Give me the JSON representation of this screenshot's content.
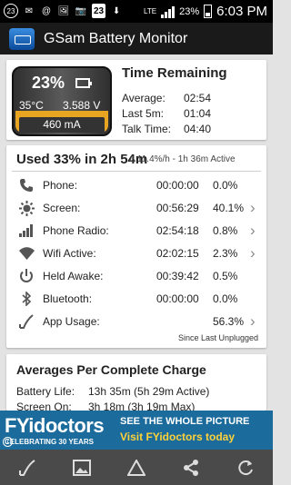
{
  "status_bar": {
    "left_icons": [
      "23",
      "✉",
      "@",
      "🖼",
      "📷",
      "23",
      "⬇"
    ],
    "network": "LTE",
    "battery_pct": "23%",
    "time": "6:03 PM"
  },
  "app": {
    "title": "GSam Battery Monitor"
  },
  "battery_card": {
    "percent": "23%",
    "temperature": "35°C",
    "voltage": "3.588 V",
    "current": "460 mA",
    "level": 0.23,
    "fill_color": "#e7a522"
  },
  "time_remaining": {
    "title": "Time Remaining",
    "rows": [
      {
        "label": "Average:",
        "value": "02:54"
      },
      {
        "label": "Last 5m:",
        "value": "01:04"
      },
      {
        "label": "Talk Time:",
        "value": "04:40"
      }
    ]
  },
  "usage": {
    "title": "Used 33% in 2h 54m",
    "rate": "Δ 11.4%/h - 1h 36m Active",
    "rows": [
      {
        "icon": "phone-icon",
        "label": "Phone:",
        "time": "00:00:00",
        "pct": "0.0%",
        "chevron": false
      },
      {
        "icon": "screen-brightness-icon",
        "label": "Screen:",
        "time": "00:56:29",
        "pct": "40.1%",
        "chevron": true
      },
      {
        "icon": "signal-bars-icon",
        "label": "Phone Radio:",
        "time": "02:54:18",
        "pct": "0.8%",
        "chevron": true
      },
      {
        "icon": "wifi-icon",
        "label": "Wifi Active:",
        "time": "02:02:15",
        "pct": "2.3%",
        "chevron": true
      },
      {
        "icon": "power-icon",
        "label": "Held Awake:",
        "time": "00:39:42",
        "pct": "0.5%",
        "chevron": false
      },
      {
        "icon": "bluetooth-icon",
        "label": "Bluetooth:",
        "time": "00:00:00",
        "pct": "0.0%",
        "chevron": false
      },
      {
        "icon": "app-usage-icon",
        "label": "App Usage:",
        "time": "",
        "pct": "56.3%",
        "chevron": true
      }
    ],
    "footer": "Since Last Unplugged"
  },
  "averages": {
    "title": "Averages Per Complete Charge",
    "rows": [
      {
        "label": "Battery Life:",
        "value": "13h 35m (5h 29m Active)"
      },
      {
        "label": "Screen On:",
        "value": "3h 18m (3h 19m Max)"
      }
    ]
  },
  "ad": {
    "logo": "FYidoctors",
    "logo_sub": "CELEBRATING 30 YEARS",
    "line1": "SEE THE WHOLE PICTURE",
    "line2": "Visit FYidoctors today",
    "info": "i"
  },
  "bottom_bar": [
    "graph-icon",
    "image-icon",
    "triangle-icon",
    "share-icon",
    "refresh-icon"
  ]
}
